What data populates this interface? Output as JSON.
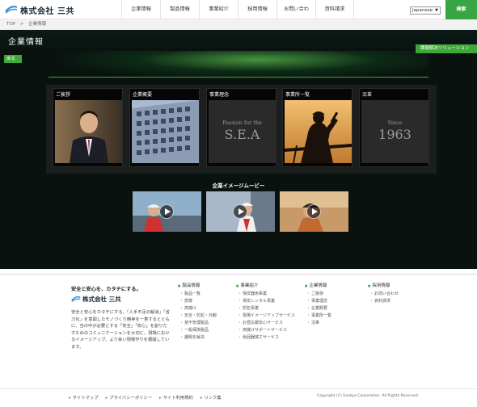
{
  "header": {
    "logo_text": "株式会社 三共",
    "nav": [
      "企業情報",
      "製品情報",
      "事業紹介",
      "採用情報",
      "お問い合わせ",
      "資料請求"
    ],
    "language": "Japanese",
    "search_label": "検索"
  },
  "breadcrumb": [
    "TOP",
    ">",
    "企業情報"
  ],
  "hero": {
    "page_title": "企業情報",
    "solution_label": "課題解決ソリューション",
    "back_label": "戻る",
    "cards": [
      {
        "label": "ご挨拶"
      },
      {
        "label": "企業概要"
      },
      {
        "label": "事業理念",
        "text_top": "Passion for the",
        "text_big": "S.E.A"
      },
      {
        "label": "事業所一覧"
      },
      {
        "label": "沿革",
        "text_top": "Since",
        "text_big": "1963"
      }
    ],
    "movie_title": "企業イメージムービー"
  },
  "footer": {
    "tagline": "安全と安心を、カタチにする。",
    "logo_text": "株式会社 三共",
    "description": "安全と安心をカタチにする。「人手不足の解消」「省力化」を意図したモノづくり精神を一貫するとともに、当の中が必要とする「安全」「安心」を創りだすためのコミュニケーションを大切に、現場におけるイメージアップ、より良い現場作りを展開しています。",
    "columns": [
      {
        "heading": "製品情報",
        "items": [
          "製品一覧",
          "部専",
          "高機け",
          "安全・防犯・外観",
          "使不管理製品",
          "一般保険製品",
          "課題を解決"
        ]
      },
      {
        "heading": "事業紹介",
        "items": [
          "保安器用事業",
          "保安レンタル事業",
          "防犯事業",
          "現場イメージアップサービス",
          "お昼広報安心サービス",
          "高機けサポートサービス",
          "仮囲器械工サービス"
        ]
      },
      {
        "heading": "企業情報",
        "items": [
          "ご挨拶",
          "事業理念",
          "企業概要",
          "事業所一覧",
          "沿革"
        ]
      },
      {
        "heading": "採用情報",
        "items": [
          "お問い合わせ",
          "資料請求"
        ]
      }
    ],
    "bottom_links": [
      "サイトマップ",
      "プライバシーポリシー",
      "サイト利用規約",
      "リンク集"
    ],
    "copyright": "Copyright (C) Sankyo Corporation. All Rights Reserved."
  },
  "colors": {
    "accent": "#3fa83a",
    "dark_bg": "#0a1210"
  }
}
